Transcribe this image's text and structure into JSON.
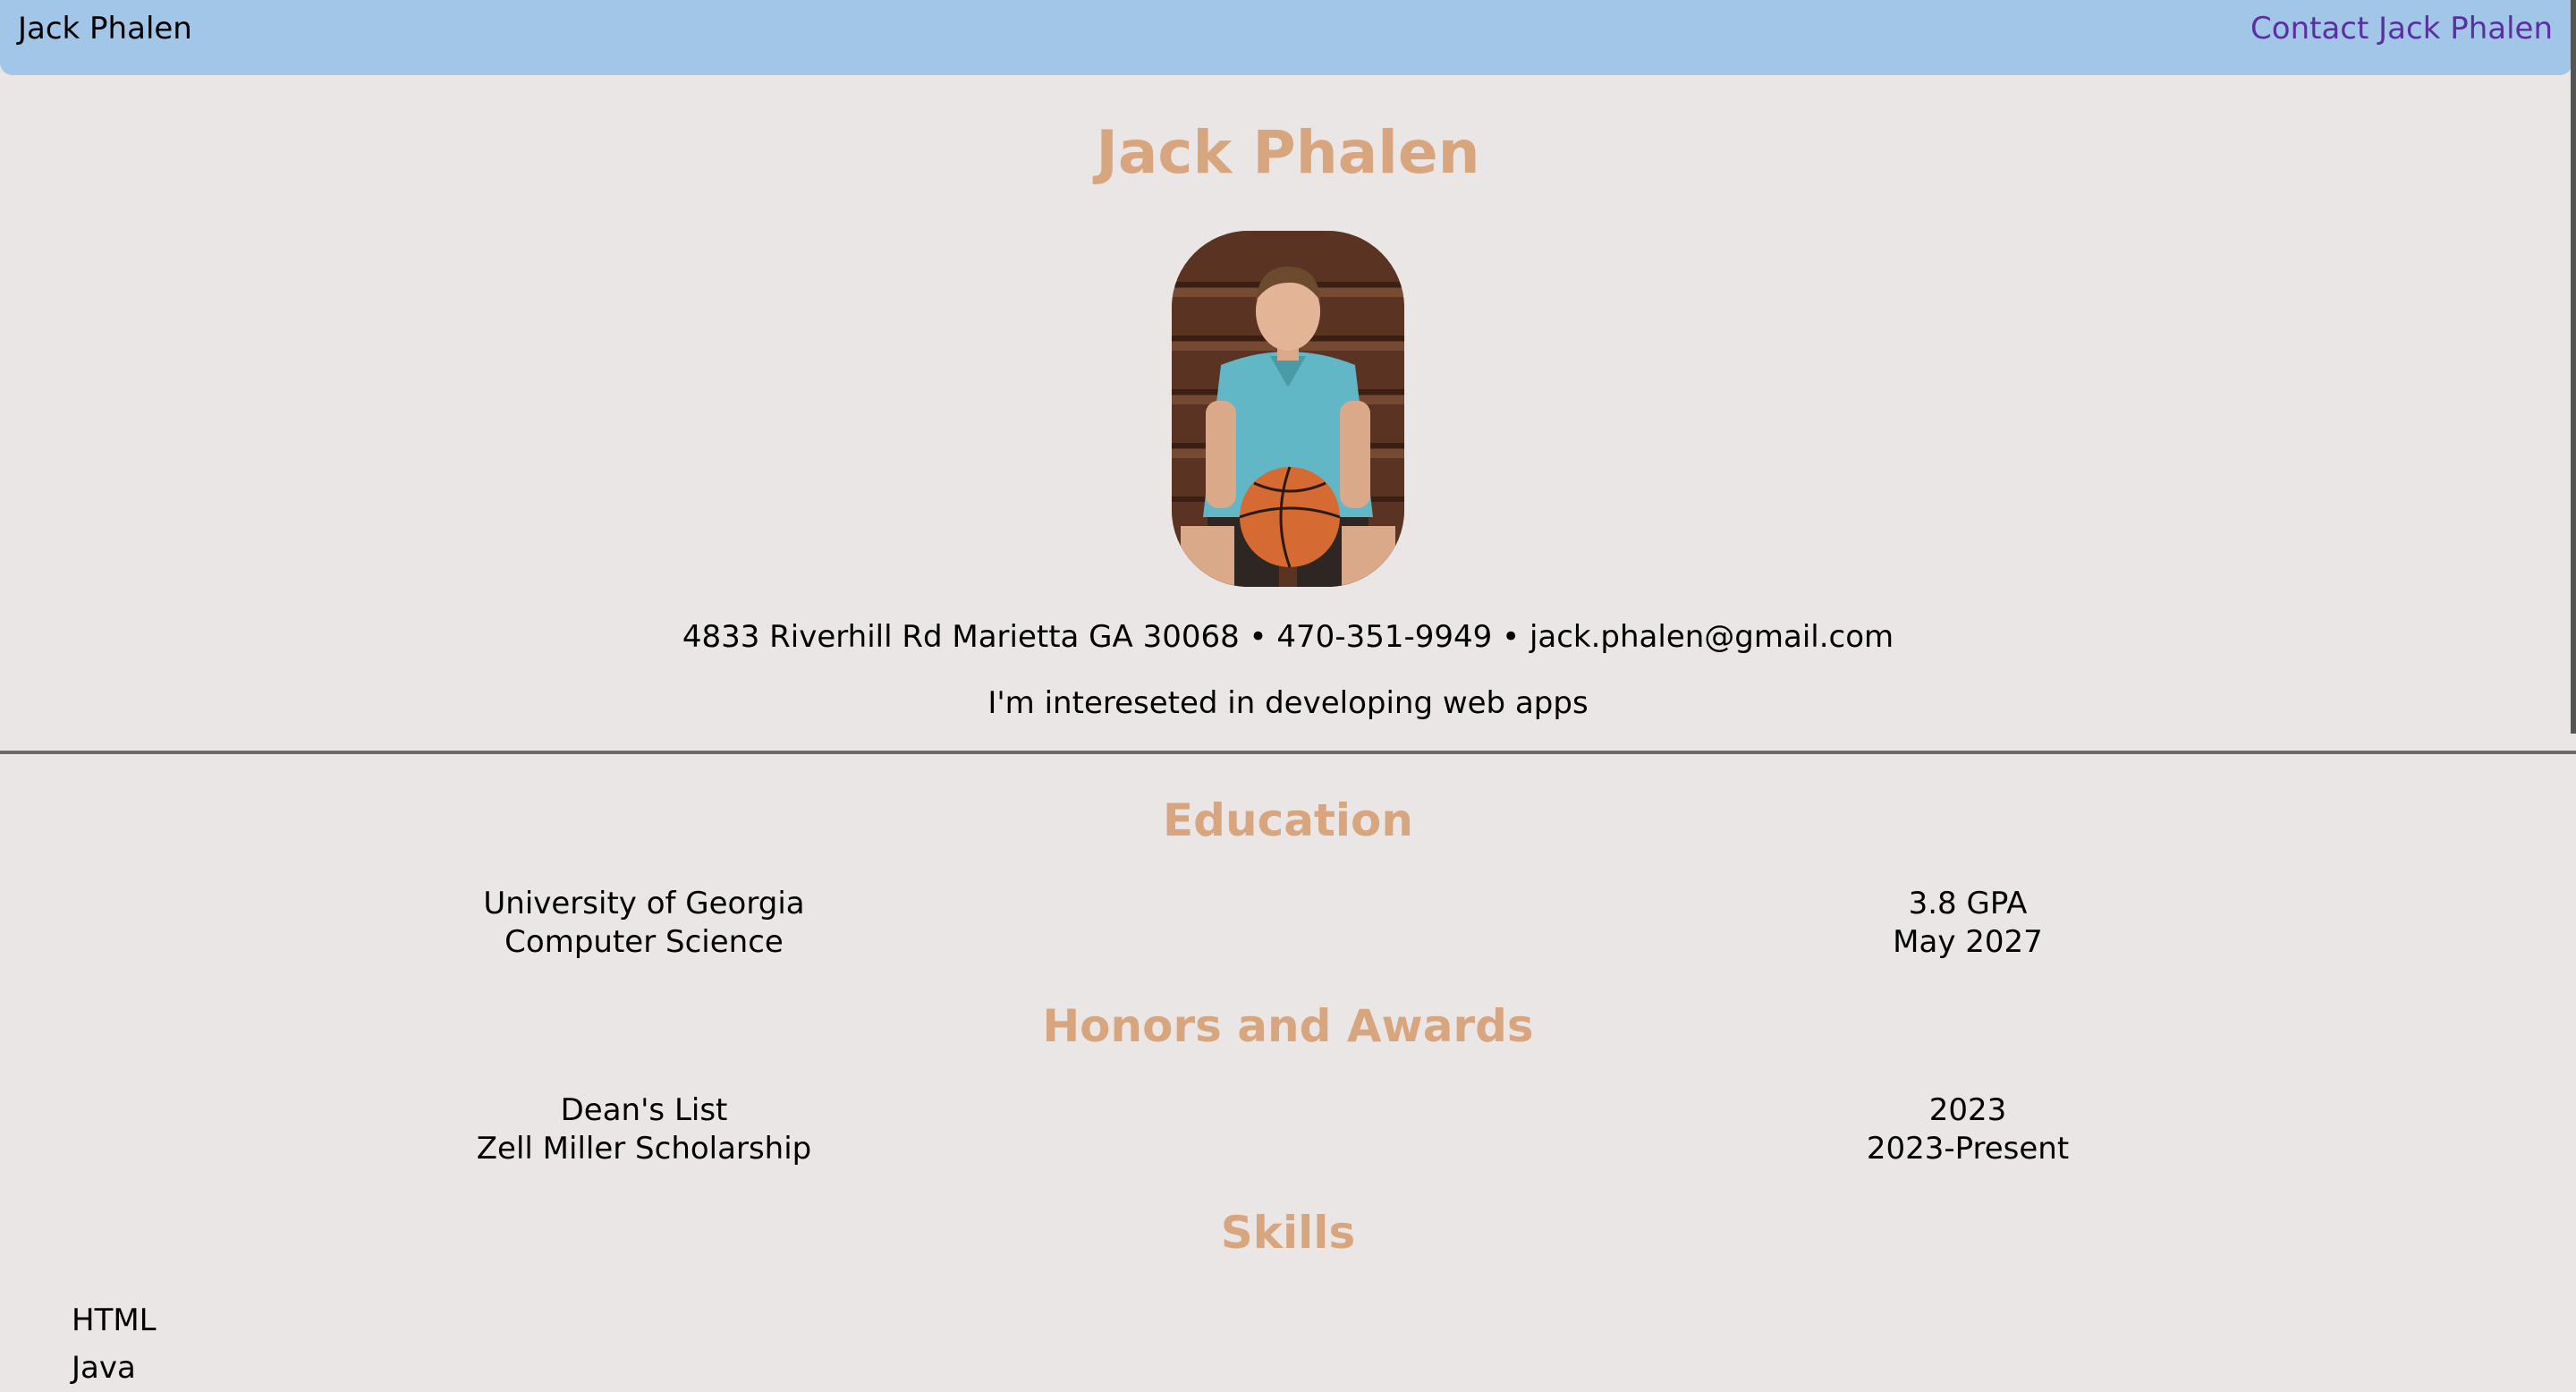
{
  "nav": {
    "brand": "Jack Phalen",
    "contact_link": "Contact Jack Phalen"
  },
  "hero": {
    "title": "Jack Phalen",
    "contact_line": "4833 Riverhill Rd Marietta GA 30068 • 470-351-9949 • jack.phalen@gmail.com",
    "tagline": "I'm intereseted in developing web apps"
  },
  "education": {
    "title": "Education",
    "left": [
      "University of Georgia",
      "Computer Science"
    ],
    "right": [
      "3.8 GPA",
      "May 2027"
    ]
  },
  "honors": {
    "title": "Honors and Awards",
    "left": [
      "Dean's List",
      "Zell Miller Scholarship"
    ],
    "right": [
      "2023",
      "2023-Present"
    ]
  },
  "skills": {
    "title": "Skills",
    "items": [
      "HTML",
      "Java"
    ]
  },
  "colors": {
    "nav_bg": "#a2c6e8",
    "heading": "#d8a67e",
    "page_bg": "#ebe6e6",
    "link": "#5a2fa0"
  }
}
